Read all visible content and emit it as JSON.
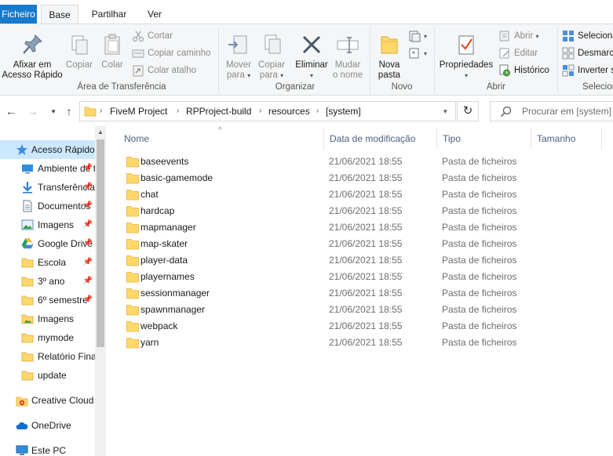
{
  "tabs": {
    "file": "Ficheiro",
    "home": "Base",
    "share": "Partilhar",
    "view": "Ver"
  },
  "ribbon": {
    "clipboard": {
      "pin_line1": "Afixar em",
      "pin_line2": "Acesso Rápido",
      "copy": "Copiar",
      "paste": "Colar",
      "cut": "Cortar",
      "copy_path": "Copiar caminho",
      "paste_shortcut": "Colar atalho",
      "label": "Área de Transferência"
    },
    "organize": {
      "move_line1": "Mover",
      "move_line2": "para",
      "copy_line1": "Copiar",
      "copy_line2": "para",
      "delete": "Eliminar",
      "rename_line1": "Mudar",
      "rename_line2": "o nome",
      "label": "Organizar"
    },
    "new": {
      "folder_line1": "Nova",
      "folder_line2": "pasta",
      "label": "Novo"
    },
    "open": {
      "properties": "Propriedades",
      "open": "Abrir",
      "edit": "Editar",
      "history": "Histórico",
      "label": "Abrir"
    },
    "select": {
      "select_all": "Selecionar tudo",
      "select_none": "Desmarcar tudo",
      "invert": "Inverter seleção",
      "label": "Selecionar"
    }
  },
  "address": {
    "crumbs": [
      "FiveM Project",
      "RPProject-build",
      "resources",
      "[system]"
    ],
    "search_placeholder": "Procurar em [system]"
  },
  "sidebar": {
    "items": [
      {
        "label": "Acesso Rápido",
        "icon": "star-icon",
        "pinned": false
      },
      {
        "label": "Ambiente de trabalho",
        "icon": "desktop-icon",
        "pinned": true
      },
      {
        "label": "Transferências",
        "icon": "download-icon",
        "pinned": true
      },
      {
        "label": "Documentos",
        "icon": "document-icon",
        "pinned": true
      },
      {
        "label": "Imagens",
        "icon": "image-icon",
        "pinned": true
      },
      {
        "label": "Google Drive",
        "icon": "google-drive-icon",
        "pinned": true
      },
      {
        "label": "Escola",
        "icon": "folder-icon",
        "pinned": true
      },
      {
        "label": "3º ano",
        "icon": "folder-icon",
        "pinned": true
      },
      {
        "label": "6º semestre",
        "icon": "folder-icon",
        "pinned": true
      },
      {
        "label": "Imagens",
        "icon": "image-icon",
        "pinned": false
      },
      {
        "label": "mymode",
        "icon": "folder-icon",
        "pinned": false
      },
      {
        "label": "Relatório Final",
        "icon": "folder-icon",
        "pinned": false
      },
      {
        "label": "update",
        "icon": "folder-icon",
        "pinned": false
      },
      {
        "label": "Creative Cloud Files",
        "icon": "creative-cloud-icon",
        "pinned": false
      },
      {
        "label": "OneDrive",
        "icon": "onedrive-icon",
        "pinned": false
      },
      {
        "label": "Este PC",
        "icon": "pc-icon",
        "pinned": false
      }
    ]
  },
  "columns": {
    "name": "Nome",
    "date": "Data de modificação",
    "type": "Tipo",
    "size": "Tamanho"
  },
  "files": [
    {
      "name": "baseevents",
      "date": "21/06/2021 18:55",
      "type": "Pasta de ficheiros"
    },
    {
      "name": "basic-gamemode",
      "date": "21/06/2021 18:55",
      "type": "Pasta de ficheiros"
    },
    {
      "name": "chat",
      "date": "21/06/2021 18:55",
      "type": "Pasta de ficheiros"
    },
    {
      "name": "hardcap",
      "date": "21/06/2021 18:55",
      "type": "Pasta de ficheiros"
    },
    {
      "name": "mapmanager",
      "date": "21/06/2021 18:55",
      "type": "Pasta de ficheiros"
    },
    {
      "name": "map-skater",
      "date": "21/06/2021 18:55",
      "type": "Pasta de ficheiros"
    },
    {
      "name": "player-data",
      "date": "21/06/2021 18:55",
      "type": "Pasta de ficheiros"
    },
    {
      "name": "playernames",
      "date": "21/06/2021 18:55",
      "type": "Pasta de ficheiros"
    },
    {
      "name": "sessionmanager",
      "date": "21/06/2021 18:55",
      "type": "Pasta de ficheiros"
    },
    {
      "name": "spawnmanager",
      "date": "21/06/2021 18:55",
      "type": "Pasta de ficheiros"
    },
    {
      "name": "webpack",
      "date": "21/06/2021 18:55",
      "type": "Pasta de ficheiros"
    },
    {
      "name": "yarn",
      "date": "21/06/2021 18:55",
      "type": "Pasta de ficheiros"
    }
  ],
  "colors": {
    "accent": "#1979ca",
    "selection": "#cce8ff",
    "folder": "#ffd86a",
    "folder_dark": "#e8b33c"
  }
}
